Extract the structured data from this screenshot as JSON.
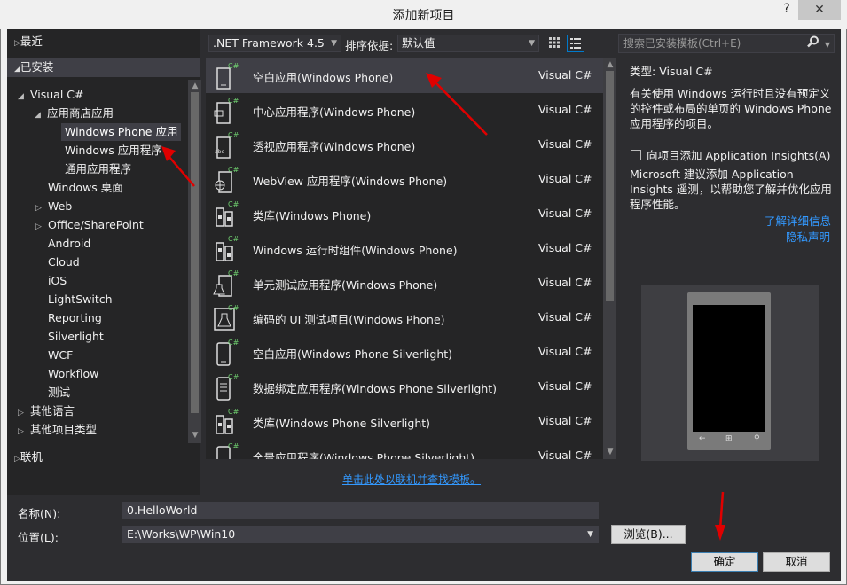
{
  "window": {
    "title": "添加新项目",
    "help_label": "?",
    "close_label": "✕"
  },
  "tree": {
    "recent": "最近",
    "installed": "已安装",
    "items": [
      {
        "label": "Visual C#",
        "arrow": "◢"
      },
      {
        "label": "应用商店应用",
        "arrow": "◢"
      },
      {
        "label": "Windows Phone 应用",
        "arrow": ""
      },
      {
        "label": "Windows 应用程序",
        "arrow": ""
      },
      {
        "label": "通用应用程序",
        "arrow": ""
      },
      {
        "label": "Windows 桌面",
        "arrow": ""
      },
      {
        "label": "Web",
        "arrow": "▷"
      },
      {
        "label": "Office/SharePoint",
        "arrow": "▷"
      },
      {
        "label": "Android",
        "arrow": ""
      },
      {
        "label": "Cloud",
        "arrow": ""
      },
      {
        "label": "iOS",
        "arrow": ""
      },
      {
        "label": "LightSwitch",
        "arrow": ""
      },
      {
        "label": "Reporting",
        "arrow": ""
      },
      {
        "label": "Silverlight",
        "arrow": ""
      },
      {
        "label": "WCF",
        "arrow": ""
      },
      {
        "label": "Workflow",
        "arrow": ""
      },
      {
        "label": "测试",
        "arrow": ""
      },
      {
        "label": "其他语言",
        "arrow": "▷"
      },
      {
        "label": "其他项目类型",
        "arrow": "▷"
      }
    ],
    "online": "联机"
  },
  "toolbar": {
    "framework": ".NET Framework 4.5",
    "sort_label": "排序依据:",
    "sort_value": "默认值"
  },
  "templates": [
    {
      "name": "空白应用(Windows Phone)",
      "lang": "Visual C#"
    },
    {
      "name": "中心应用程序(Windows Phone)",
      "lang": "Visual C#"
    },
    {
      "name": "透视应用程序(Windows Phone)",
      "lang": "Visual C#"
    },
    {
      "name": "WebView 应用程序(Windows Phone)",
      "lang": "Visual C#"
    },
    {
      "name": "类库(Windows Phone)",
      "lang": "Visual C#"
    },
    {
      "name": "Windows 运行时组件(Windows Phone)",
      "lang": "Visual C#"
    },
    {
      "name": "单元测试应用程序(Windows Phone)",
      "lang": "Visual C#"
    },
    {
      "name": "编码的 UI 测试项目(Windows Phone)",
      "lang": "Visual C#"
    },
    {
      "name": "空白应用(Windows Phone Silverlight)",
      "lang": "Visual C#"
    },
    {
      "name": "数据绑定应用程序(Windows Phone Silverlight)",
      "lang": "Visual C#"
    },
    {
      "name": "类库(Windows Phone Silverlight)",
      "lang": "Visual C#"
    },
    {
      "name": "全景应用程序(Windows Phone Silverlight)",
      "lang": "Visual C#"
    }
  ],
  "online_link": "单击此处以联机并查找模板。",
  "search": {
    "placeholder": "搜索已安装模板(Ctrl+E)"
  },
  "details": {
    "type_label": "类型:",
    "type_value": "Visual C#",
    "desc_line1": "有关使用 Windows 运行时且没有预定义",
    "desc_line2": "的控件或布局的单页的 Windows Phone",
    "desc_line3": "应用程序的项目。",
    "insights_label": "向项目添加 Application Insights(A)",
    "insights_desc1": "Microsoft 建议添加 Application",
    "insights_desc2": "Insights 遥测，以帮助您了解并优化应用",
    "insights_desc3": "程序性能。",
    "learn_more": "了解详细信息",
    "privacy": "隐私声明"
  },
  "form": {
    "name_label": "名称(N):",
    "name_value": "0.HelloWorld",
    "location_label": "位置(L):",
    "location_value": "E:\\Works\\WP\\Win10",
    "browse": "浏览(B)...",
    "ok": "确定",
    "cancel": "取消"
  },
  "colors": {
    "background": "#2d2d30",
    "panel": "#252526",
    "selection": "#3f3f46",
    "link": "#3399ff",
    "annotation": "#e00000"
  }
}
